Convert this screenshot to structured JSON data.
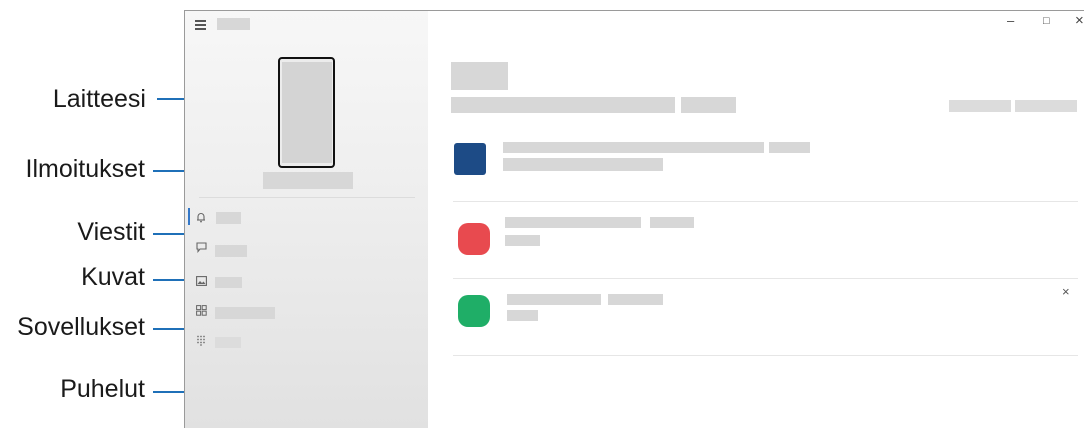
{
  "callouts": {
    "devices": "Laitteesi",
    "notifications": "Ilmoitukset",
    "messages": "Viestit",
    "photos": "Kuvat",
    "apps": "Sovellukset",
    "calls": "Puhelut"
  },
  "window_controls": {
    "minimize": "–",
    "maximize": "□",
    "close": "×"
  },
  "notification_dismiss": "×",
  "icons": {
    "menu": "hamburger-menu-icon",
    "notifications": "bell-icon",
    "messages": "chat-bubble-icon",
    "photos": "image-icon",
    "apps": "apps-grid-icon",
    "calls": "dialpad-icon"
  },
  "colors": {
    "accent": "#1f70b8",
    "app_blue": "#1d4b86",
    "app_red": "#e84a4f",
    "app_green": "#1fae67"
  }
}
